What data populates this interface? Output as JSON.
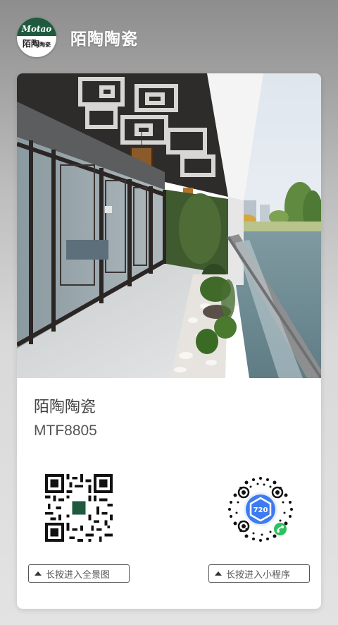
{
  "header": {
    "logo_text_top": "Motao",
    "logo_text_bottom": "陌陶",
    "logo_text_small": "陶瓷",
    "title": "陌陶陶瓷"
  },
  "product": {
    "name": "陌陶陶瓷",
    "code": "MTF8805"
  },
  "qr": {
    "left_center_logo": "Motao",
    "right_center_logo": "720"
  },
  "buttons": {
    "left_label": "长按进入全景图",
    "right_label": "长按进入小程序"
  },
  "colors": {
    "brand_green": "#1f5a3e",
    "mini_program_blue": "#3d7bf0",
    "wechat_green": "#2dc160"
  }
}
